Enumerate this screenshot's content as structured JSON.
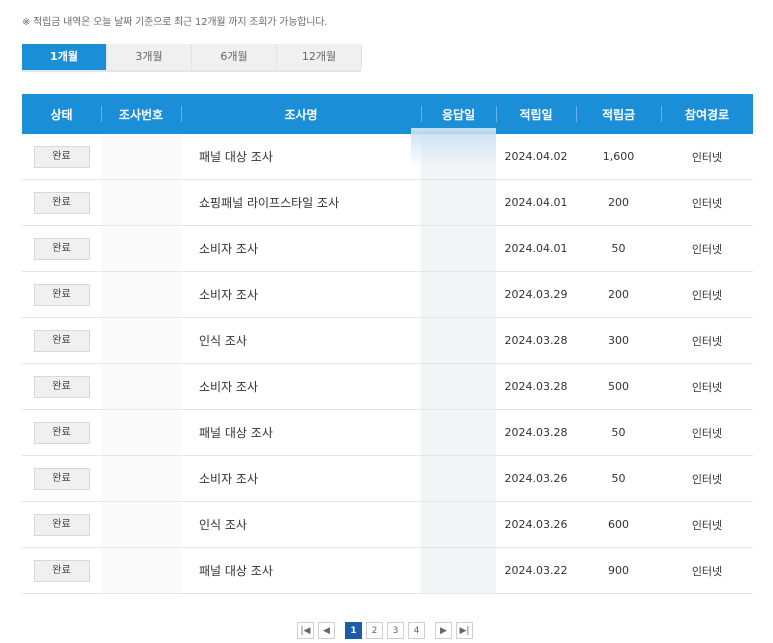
{
  "notice": "※ 적립금 내역은 오늘 날짜 기준으로 최근 12개월 까지 조회가 가능합니다.",
  "tabs": [
    {
      "label": "1개월",
      "active": true
    },
    {
      "label": "3개월",
      "active": false
    },
    {
      "label": "6개월",
      "active": false
    },
    {
      "label": "12개월",
      "active": false
    }
  ],
  "table": {
    "headers": [
      "상태",
      "조사번호",
      "조사명",
      "응답일",
      "적립일",
      "적립금",
      "참여경로"
    ],
    "rows": [
      {
        "status": "완료",
        "survey_no": "",
        "survey_name": "패널 대상 조사",
        "response_date": "",
        "accrual_date": "2024.04.02",
        "points": "1,600",
        "channel": "인터넷"
      },
      {
        "status": "완료",
        "survey_no": "",
        "survey_name": "쇼핑패널 라이프스타일 조사",
        "response_date": "",
        "accrual_date": "2024.04.01",
        "points": "200",
        "channel": "인터넷"
      },
      {
        "status": "완료",
        "survey_no": "",
        "survey_name": "소비자 조사",
        "response_date": "",
        "accrual_date": "2024.04.01",
        "points": "50",
        "channel": "인터넷"
      },
      {
        "status": "완료",
        "survey_no": "",
        "survey_name": "소비자 조사",
        "response_date": "",
        "accrual_date": "2024.03.29",
        "points": "200",
        "channel": "인터넷"
      },
      {
        "status": "완료",
        "survey_no": "",
        "survey_name": "인식 조사",
        "response_date": "",
        "accrual_date": "2024.03.28",
        "points": "300",
        "channel": "인터넷"
      },
      {
        "status": "완료",
        "survey_no": "",
        "survey_name": "소비자 조사",
        "response_date": "",
        "accrual_date": "2024.03.28",
        "points": "500",
        "channel": "인터넷"
      },
      {
        "status": "완료",
        "survey_no": "",
        "survey_name": "패널 대상 조사",
        "response_date": "",
        "accrual_date": "2024.03.28",
        "points": "50",
        "channel": "인터넷"
      },
      {
        "status": "완료",
        "survey_no": "",
        "survey_name": "소비자 조사",
        "response_date": "",
        "accrual_date": "2024.03.26",
        "points": "50",
        "channel": "인터넷"
      },
      {
        "status": "완료",
        "survey_no": "",
        "survey_name": "인식 조사",
        "response_date": "",
        "accrual_date": "2024.03.26",
        "points": "600",
        "channel": "인터넷"
      },
      {
        "status": "완료",
        "survey_no": "",
        "survey_name": "패널 대상 조사",
        "response_date": "",
        "accrual_date": "2024.03.22",
        "points": "900",
        "channel": "인터넷"
      }
    ]
  },
  "pagination": {
    "first": "|◀",
    "prev": "◀",
    "pages": [
      "1",
      "2",
      "3",
      "4"
    ],
    "current": "1",
    "next": "▶",
    "last": "▶|"
  },
  "colors": {
    "accent": "#1a8fd8",
    "pager_active": "#1a5da8"
  }
}
